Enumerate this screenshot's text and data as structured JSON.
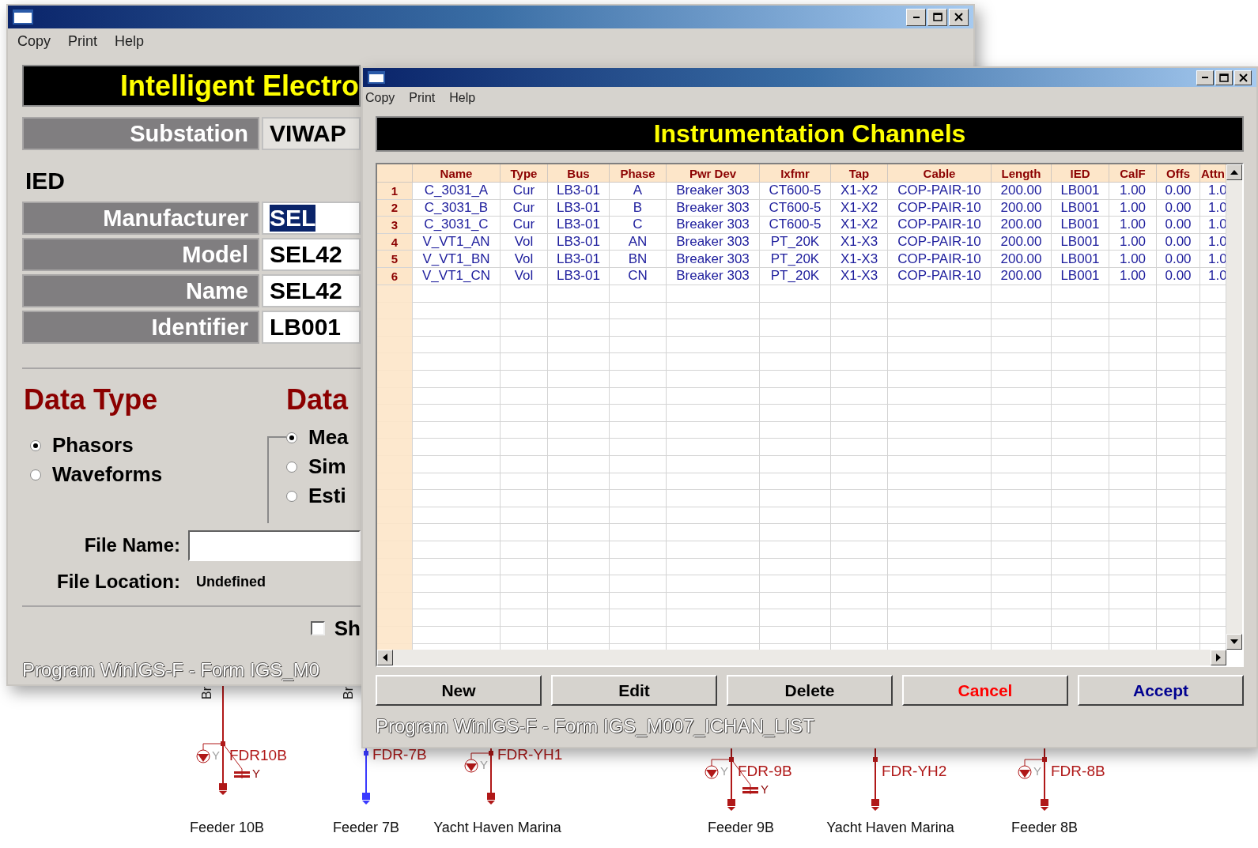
{
  "back_window": {
    "menu": [
      "Copy",
      "Print",
      "Help"
    ],
    "header": "Intelligent Electro",
    "substation": {
      "label": "Substation",
      "value": "VIWAP"
    },
    "section": "IED",
    "fields": [
      {
        "label": "Manufacturer",
        "value": "SEL",
        "selected": true
      },
      {
        "label": "Model",
        "value": "SEL42",
        "selected": false
      },
      {
        "label": "Name",
        "value": "SEL42",
        "selected": false
      },
      {
        "label": "Identifier",
        "value": "LB001",
        "selected": false
      }
    ],
    "data_type": {
      "title": "Data Type",
      "options": [
        {
          "label": "Phasors",
          "selected": true
        },
        {
          "label": "Waveforms",
          "selected": false
        }
      ]
    },
    "data_source": {
      "title": "Data",
      "options": [
        {
          "label": "Mea",
          "selected": true
        },
        {
          "label": "Sim",
          "selected": false
        },
        {
          "label": "Esti",
          "selected": false
        }
      ]
    },
    "file_name": {
      "label": "File Name:"
    },
    "file_location": {
      "label": "File Location:",
      "value": "Undefined"
    },
    "show_checkbox": {
      "label": "Sh",
      "checked": false
    },
    "footer": "Program WinIGS-F - Form IGS_M0"
  },
  "front_window": {
    "menu": [
      "Copy",
      "Print",
      "Help"
    ],
    "header": "Instrumentation Channels",
    "table": {
      "columns": [
        "Name",
        "Type",
        "Bus",
        "Phase",
        "Pwr Dev",
        "Ixfmr",
        "Tap",
        "Cable",
        "Length",
        "IED",
        "CalF",
        "Offs",
        "Attn"
      ],
      "rows": [
        {
          "number": "1",
          "cells": [
            "C_3031_A",
            "Cur",
            "LB3-01",
            "A",
            "Breaker 303",
            "CT600-5",
            "X1-X2",
            "COP-PAIR-10",
            "200.00",
            "LB001",
            "1.00",
            "0.00",
            "1.0"
          ]
        },
        {
          "number": "2",
          "cells": [
            "C_3031_B",
            "Cur",
            "LB3-01",
            "B",
            "Breaker 303",
            "CT600-5",
            "X1-X2",
            "COP-PAIR-10",
            "200.00",
            "LB001",
            "1.00",
            "0.00",
            "1.0"
          ]
        },
        {
          "number": "3",
          "cells": [
            "C_3031_C",
            "Cur",
            "LB3-01",
            "C",
            "Breaker 303",
            "CT600-5",
            "X1-X2",
            "COP-PAIR-10",
            "200.00",
            "LB001",
            "1.00",
            "0.00",
            "1.0"
          ]
        },
        {
          "number": "4",
          "cells": [
            "V_VT1_AN",
            "Vol",
            "LB3-01",
            "AN",
            "Breaker 303",
            "PT_20K",
            "X1-X3",
            "COP-PAIR-10",
            "200.00",
            "LB001",
            "1.00",
            "0.00",
            "1.0"
          ]
        },
        {
          "number": "5",
          "cells": [
            "V_VT1_BN",
            "Vol",
            "LB3-01",
            "BN",
            "Breaker 303",
            "PT_20K",
            "X1-X3",
            "COP-PAIR-10",
            "200.00",
            "LB001",
            "1.00",
            "0.00",
            "1.0"
          ]
        },
        {
          "number": "6",
          "cells": [
            "V_VT1_CN",
            "Vol",
            "LB3-01",
            "CN",
            "Breaker 303",
            "PT_20K",
            "X1-X3",
            "COP-PAIR-10",
            "200.00",
            "LB001",
            "1.00",
            "0.00",
            "1.0"
          ]
        }
      ]
    },
    "buttons": [
      {
        "label": "New",
        "kind": "plain"
      },
      {
        "label": "Edit",
        "kind": "plain"
      },
      {
        "label": "Delete",
        "kind": "plain"
      },
      {
        "label": "Cancel",
        "kind": "cancel"
      },
      {
        "label": "Accept",
        "kind": "accept"
      }
    ],
    "footer": "Program WinIGS-F - Form IGS_M007_ICHAN_LIST"
  },
  "diagram": {
    "bus_labels": [
      "Br",
      "Br"
    ],
    "feeders": [
      {
        "code": "FDR10B",
        "name": "Feeder 10B",
        "color": "#b01818",
        "load_mark": "Y",
        "capacitor_mark": "Y"
      },
      {
        "code": "FDR-7B",
        "name": "Feeder 7B",
        "color": "#3a3aff"
      },
      {
        "code": "FDR-YH1",
        "name": "Yacht Haven Marina",
        "color": "#b01818",
        "load_mark": "Y"
      },
      {
        "code": "FDR-9B",
        "name": "Feeder 9B",
        "color": "#b01818",
        "load_mark": "Y",
        "capacitor_mark": "Y"
      },
      {
        "code": "FDR-YH2",
        "name": "Yacht Haven Marina",
        "color": "#b01818"
      },
      {
        "code": "FDR-8B",
        "name": "Feeder 8B",
        "color": "#b01818",
        "load_mark": "Y"
      }
    ]
  }
}
